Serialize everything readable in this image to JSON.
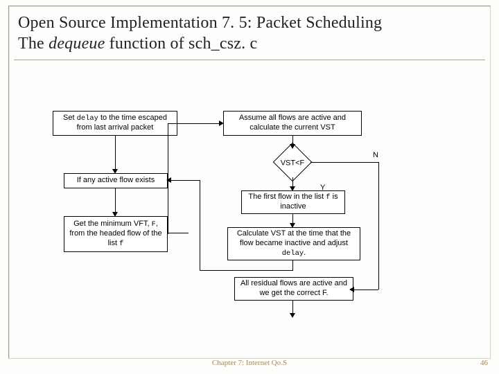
{
  "title_line1": "Open Source Implementation 7. 5: Packet Scheduling",
  "title_line2_pre": "The ",
  "title_line2_em": "dequeue",
  "title_line2_post": " function of sch_csz. c",
  "footer_chapter": "Chapter 7: Internet Qo.S",
  "page_number": "46",
  "nodes": {
    "set_delay_pre": "Set ",
    "set_delay_code": "delay",
    "set_delay_post": " to the time escaped from last arrival packet",
    "any_active": "If any active flow exists",
    "get_min_pre": "Get the minimum VFT, ",
    "get_min_code1": "F",
    "get_min_mid": ", from the headed flow of the list ",
    "get_min_code2": "f",
    "assume_all": "Assume all flows are active and calculate the current VST",
    "decision": "VST<F",
    "first_inactive_pre": "The first flow in the list ",
    "first_inactive_code": "f",
    "first_inactive_post": " is inactive",
    "calc_vst_pre": "Calculate VST at the time that the flow became inactive and adjust ",
    "calc_vst_code": "delay",
    "calc_vst_post": ".",
    "residual": "All residual flows are active and we get the correct F."
  },
  "labels": {
    "Y": "Y",
    "N": "N"
  },
  "chart_data": {
    "type": "flowchart",
    "title": "Open Source Implementation 7.5: Packet Scheduling — The dequeue function of sch_csz.c",
    "nodes": [
      {
        "id": "A",
        "shape": "process",
        "text": "Set delay to the time escaped from last arrival packet"
      },
      {
        "id": "B",
        "shape": "process",
        "text": "If any active flow exists"
      },
      {
        "id": "C",
        "shape": "process",
        "text": "Get the minimum VFT, F, from the headed flow of the list f"
      },
      {
        "id": "D",
        "shape": "process",
        "text": "Assume all flows are active and calculate the current VST"
      },
      {
        "id": "E",
        "shape": "decision",
        "text": "VST<F"
      },
      {
        "id": "F",
        "shape": "process",
        "text": "The first flow in the list f is inactive"
      },
      {
        "id": "G",
        "shape": "process",
        "text": "Calculate VST at the time that the flow became inactive and adjust delay."
      },
      {
        "id": "H",
        "shape": "process",
        "text": "All residual flows are active and we get the correct F."
      }
    ],
    "edges": [
      {
        "from": "A",
        "to": "B"
      },
      {
        "from": "B",
        "to": "C"
      },
      {
        "from": "C",
        "to": "D"
      },
      {
        "from": "D",
        "to": "E"
      },
      {
        "from": "E",
        "to": "F",
        "label": "Y"
      },
      {
        "from": "E",
        "to": "H",
        "label": "N"
      },
      {
        "from": "F",
        "to": "G"
      },
      {
        "from": "G",
        "to": "B",
        "note": "loop back"
      },
      {
        "from": "H",
        "to": null,
        "note": "exit"
      }
    ]
  }
}
